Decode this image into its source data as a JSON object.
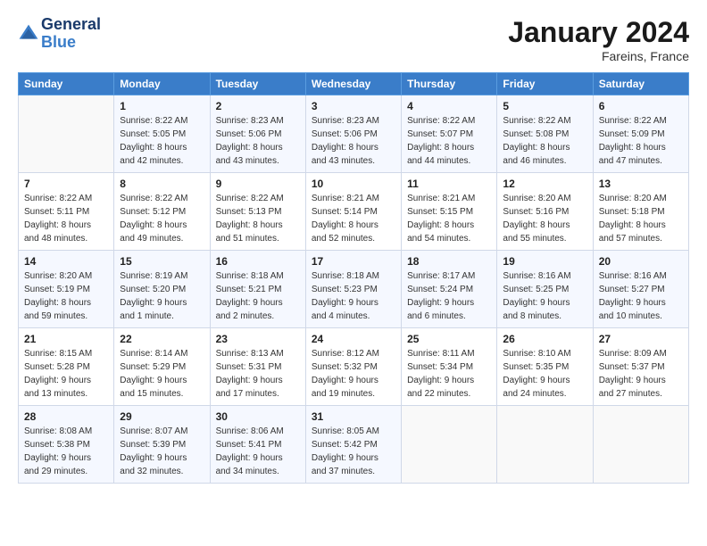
{
  "header": {
    "logo_line1": "General",
    "logo_line2": "Blue",
    "month": "January 2024",
    "location": "Fareins, France"
  },
  "days_of_week": [
    "Sunday",
    "Monday",
    "Tuesday",
    "Wednesday",
    "Thursday",
    "Friday",
    "Saturday"
  ],
  "weeks": [
    [
      {
        "day": "",
        "info": ""
      },
      {
        "day": "1",
        "info": "Sunrise: 8:22 AM\nSunset: 5:05 PM\nDaylight: 8 hours\nand 42 minutes."
      },
      {
        "day": "2",
        "info": "Sunrise: 8:23 AM\nSunset: 5:06 PM\nDaylight: 8 hours\nand 43 minutes."
      },
      {
        "day": "3",
        "info": "Sunrise: 8:23 AM\nSunset: 5:06 PM\nDaylight: 8 hours\nand 43 minutes."
      },
      {
        "day": "4",
        "info": "Sunrise: 8:22 AM\nSunset: 5:07 PM\nDaylight: 8 hours\nand 44 minutes."
      },
      {
        "day": "5",
        "info": "Sunrise: 8:22 AM\nSunset: 5:08 PM\nDaylight: 8 hours\nand 46 minutes."
      },
      {
        "day": "6",
        "info": "Sunrise: 8:22 AM\nSunset: 5:09 PM\nDaylight: 8 hours\nand 47 minutes."
      }
    ],
    [
      {
        "day": "7",
        "info": "Sunrise: 8:22 AM\nSunset: 5:11 PM\nDaylight: 8 hours\nand 48 minutes."
      },
      {
        "day": "8",
        "info": "Sunrise: 8:22 AM\nSunset: 5:12 PM\nDaylight: 8 hours\nand 49 minutes."
      },
      {
        "day": "9",
        "info": "Sunrise: 8:22 AM\nSunset: 5:13 PM\nDaylight: 8 hours\nand 51 minutes."
      },
      {
        "day": "10",
        "info": "Sunrise: 8:21 AM\nSunset: 5:14 PM\nDaylight: 8 hours\nand 52 minutes."
      },
      {
        "day": "11",
        "info": "Sunrise: 8:21 AM\nSunset: 5:15 PM\nDaylight: 8 hours\nand 54 minutes."
      },
      {
        "day": "12",
        "info": "Sunrise: 8:20 AM\nSunset: 5:16 PM\nDaylight: 8 hours\nand 55 minutes."
      },
      {
        "day": "13",
        "info": "Sunrise: 8:20 AM\nSunset: 5:18 PM\nDaylight: 8 hours\nand 57 minutes."
      }
    ],
    [
      {
        "day": "14",
        "info": "Sunrise: 8:20 AM\nSunset: 5:19 PM\nDaylight: 8 hours\nand 59 minutes."
      },
      {
        "day": "15",
        "info": "Sunrise: 8:19 AM\nSunset: 5:20 PM\nDaylight: 9 hours\nand 1 minute."
      },
      {
        "day": "16",
        "info": "Sunrise: 8:18 AM\nSunset: 5:21 PM\nDaylight: 9 hours\nand 2 minutes."
      },
      {
        "day": "17",
        "info": "Sunrise: 8:18 AM\nSunset: 5:23 PM\nDaylight: 9 hours\nand 4 minutes."
      },
      {
        "day": "18",
        "info": "Sunrise: 8:17 AM\nSunset: 5:24 PM\nDaylight: 9 hours\nand 6 minutes."
      },
      {
        "day": "19",
        "info": "Sunrise: 8:16 AM\nSunset: 5:25 PM\nDaylight: 9 hours\nand 8 minutes."
      },
      {
        "day": "20",
        "info": "Sunrise: 8:16 AM\nSunset: 5:27 PM\nDaylight: 9 hours\nand 10 minutes."
      }
    ],
    [
      {
        "day": "21",
        "info": "Sunrise: 8:15 AM\nSunset: 5:28 PM\nDaylight: 9 hours\nand 13 minutes."
      },
      {
        "day": "22",
        "info": "Sunrise: 8:14 AM\nSunset: 5:29 PM\nDaylight: 9 hours\nand 15 minutes."
      },
      {
        "day": "23",
        "info": "Sunrise: 8:13 AM\nSunset: 5:31 PM\nDaylight: 9 hours\nand 17 minutes."
      },
      {
        "day": "24",
        "info": "Sunrise: 8:12 AM\nSunset: 5:32 PM\nDaylight: 9 hours\nand 19 minutes."
      },
      {
        "day": "25",
        "info": "Sunrise: 8:11 AM\nSunset: 5:34 PM\nDaylight: 9 hours\nand 22 minutes."
      },
      {
        "day": "26",
        "info": "Sunrise: 8:10 AM\nSunset: 5:35 PM\nDaylight: 9 hours\nand 24 minutes."
      },
      {
        "day": "27",
        "info": "Sunrise: 8:09 AM\nSunset: 5:37 PM\nDaylight: 9 hours\nand 27 minutes."
      }
    ],
    [
      {
        "day": "28",
        "info": "Sunrise: 8:08 AM\nSunset: 5:38 PM\nDaylight: 9 hours\nand 29 minutes."
      },
      {
        "day": "29",
        "info": "Sunrise: 8:07 AM\nSunset: 5:39 PM\nDaylight: 9 hours\nand 32 minutes."
      },
      {
        "day": "30",
        "info": "Sunrise: 8:06 AM\nSunset: 5:41 PM\nDaylight: 9 hours\nand 34 minutes."
      },
      {
        "day": "31",
        "info": "Sunrise: 8:05 AM\nSunset: 5:42 PM\nDaylight: 9 hours\nand 37 minutes."
      },
      {
        "day": "",
        "info": ""
      },
      {
        "day": "",
        "info": ""
      },
      {
        "day": "",
        "info": ""
      }
    ]
  ]
}
